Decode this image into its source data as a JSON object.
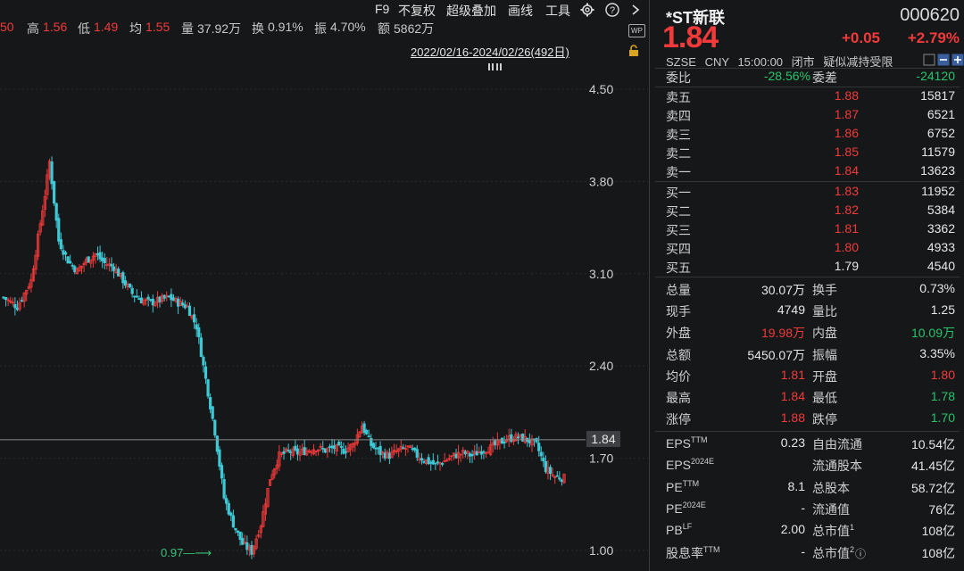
{
  "quote_bar": {
    "partial_open": "50",
    "high_label": "高",
    "high_value": "1.56",
    "low_label": "低",
    "low_value": "1.49",
    "avg_label": "均",
    "avg_value": "1.55",
    "volume_label": "量",
    "volume_value": "37.92万",
    "turnover_label": "换",
    "turnover_value": "0.91%",
    "amplitude_label": "振",
    "amplitude_value": "4.70%",
    "amount_label": "额",
    "amount_value": "5862万"
  },
  "toolbar": {
    "f9": "F9",
    "no_adjust": "不复权",
    "overlay": "超级叠加",
    "draw": "画线",
    "tools": "工具",
    "wp_badge": "WP"
  },
  "date_range": "2022/02/16-2024/02/26(492日)",
  "chart_data": {
    "type": "candlestick",
    "y_ticks": [
      "4.50",
      "3.80",
      "3.10",
      "2.40",
      "1.70",
      "1.00"
    ],
    "ylim": [
      1.0,
      4.5
    ],
    "current_price_label": "1.84",
    "current_price": 1.84,
    "min_label": "0.97",
    "min_value": 0.97,
    "approx_close_path": [
      {
        "i": 0,
        "c": 2.92
      },
      {
        "i": 3,
        "c": 2.85
      },
      {
        "i": 6,
        "c": 3.05
      },
      {
        "i": 9,
        "c": 3.7
      },
      {
        "i": 10,
        "c": 3.95
      },
      {
        "i": 12,
        "c": 3.35
      },
      {
        "i": 14,
        "c": 3.2
      },
      {
        "i": 16,
        "c": 3.12
      },
      {
        "i": 18,
        "c": 3.2
      },
      {
        "i": 20,
        "c": 3.25
      },
      {
        "i": 22,
        "c": 3.18
      },
      {
        "i": 24,
        "c": 3.15
      },
      {
        "i": 26,
        "c": 3.05
      },
      {
        "i": 28,
        "c": 2.95
      },
      {
        "i": 30,
        "c": 2.9
      },
      {
        "i": 32,
        "c": 2.88
      },
      {
        "i": 34,
        "c": 2.9
      },
      {
        "i": 36,
        "c": 2.92
      },
      {
        "i": 38,
        "c": 2.88
      },
      {
        "i": 40,
        "c": 2.85
      },
      {
        "i": 42,
        "c": 2.7
      },
      {
        "i": 44,
        "c": 2.3
      },
      {
        "i": 46,
        "c": 1.9
      },
      {
        "i": 48,
        "c": 1.4
      },
      {
        "i": 50,
        "c": 1.2
      },
      {
        "i": 52,
        "c": 1.05
      },
      {
        "i": 54,
        "c": 0.99
      },
      {
        "i": 56,
        "c": 1.2
      },
      {
        "i": 58,
        "c": 1.55
      },
      {
        "i": 60,
        "c": 1.72
      },
      {
        "i": 62,
        "c": 1.75
      },
      {
        "i": 64,
        "c": 1.74
      },
      {
        "i": 66,
        "c": 1.76
      },
      {
        "i": 68,
        "c": 1.78
      },
      {
        "i": 70,
        "c": 1.76
      },
      {
        "i": 72,
        "c": 1.78
      },
      {
        "i": 74,
        "c": 1.76
      },
      {
        "i": 76,
        "c": 1.8
      },
      {
        "i": 78,
        "c": 1.95
      },
      {
        "i": 80,
        "c": 1.8
      },
      {
        "i": 82,
        "c": 1.74
      },
      {
        "i": 84,
        "c": 1.72
      },
      {
        "i": 86,
        "c": 1.76
      },
      {
        "i": 88,
        "c": 1.78
      },
      {
        "i": 90,
        "c": 1.72
      },
      {
        "i": 92,
        "c": 1.68
      },
      {
        "i": 94,
        "c": 1.65
      },
      {
        "i": 96,
        "c": 1.68
      },
      {
        "i": 98,
        "c": 1.72
      },
      {
        "i": 100,
        "c": 1.74
      },
      {
        "i": 102,
        "c": 1.72
      },
      {
        "i": 104,
        "c": 1.76
      },
      {
        "i": 106,
        "c": 1.78
      },
      {
        "i": 108,
        "c": 1.82
      },
      {
        "i": 110,
        "c": 1.85
      },
      {
        "i": 112,
        "c": 1.86
      },
      {
        "i": 114,
        "c": 1.84
      },
      {
        "i": 116,
        "c": 1.8
      },
      {
        "i": 118,
        "c": 1.62
      },
      {
        "i": 120,
        "c": 1.56
      },
      {
        "i": 122,
        "c": 1.55
      }
    ],
    "colors": {
      "up": "#f23a3a",
      "down": "#3fc9d6",
      "flat": "#e8e0a0",
      "grid": "#2a2c30",
      "price_line": "#8a8a8a"
    }
  },
  "stock": {
    "name": "*ST新联",
    "code": "000620",
    "price": "1.84",
    "change": "+0.05",
    "change_pct": "+2.79%",
    "exchange": "SZSE",
    "currency": "CNY",
    "time": "15:00:00",
    "status": "闭市",
    "flag": "疑似减持受限"
  },
  "book": {
    "ratio_label": "委比",
    "ratio_value": "-28.56%",
    "diff_label": "委差",
    "diff_value": "-24120",
    "asks": [
      {
        "label": "卖五",
        "price": "1.88",
        "qty": "15817"
      },
      {
        "label": "卖四",
        "price": "1.87",
        "qty": "6521"
      },
      {
        "label": "卖三",
        "price": "1.86",
        "qty": "6752"
      },
      {
        "label": "卖二",
        "price": "1.85",
        "qty": "11579"
      },
      {
        "label": "卖一",
        "price": "1.84",
        "qty": "13623"
      }
    ],
    "bids": [
      {
        "label": "买一",
        "price": "1.83",
        "qty": "11952"
      },
      {
        "label": "买二",
        "price": "1.82",
        "qty": "5384"
      },
      {
        "label": "买三",
        "price": "1.81",
        "qty": "3362"
      },
      {
        "label": "买四",
        "price": "1.80",
        "qty": "4933"
      },
      {
        "label": "买五",
        "price": "1.79",
        "qty": "4540"
      }
    ]
  },
  "stats": {
    "total_vol_label": "总量",
    "total_vol": "30.07万",
    "turn_label": "换手",
    "turn": "0.73%",
    "cur_vol_label": "现手",
    "cur_vol": "4749",
    "vol_ratio_label": "量比",
    "vol_ratio": "1.25",
    "outer_label": "外盘",
    "outer": "19.98万",
    "inner_label": "内盘",
    "inner": "10.09万",
    "amount_label": "总额",
    "amount": "5450.07万",
    "amp_label": "振幅",
    "amp": "3.35%",
    "avg_label": "均价",
    "avg": "1.81",
    "open_label": "开盘",
    "open": "1.80",
    "high_label": "最高",
    "high": "1.84",
    "low_label": "最低",
    "low": "1.78",
    "limit_up_label": "涨停",
    "limit_up": "1.88",
    "limit_down_label": "跌停",
    "limit_down": "1.70"
  },
  "fundamentals": {
    "eps_ttm_label": "EPS",
    "eps_ttm_sup": "TTM",
    "eps_ttm": "0.23",
    "free_float_label": "自由流通",
    "free_float": "10.54亿",
    "eps_2024_label": "EPS",
    "eps_2024_sup": "2024E",
    "eps_2024": "",
    "float_shares_label": "流通股本",
    "float_shares": "41.45亿",
    "pe_ttm_label": "PE",
    "pe_ttm_sup": "TTM",
    "pe_ttm": "8.1",
    "total_shares_label": "总股本",
    "total_shares": "58.72亿",
    "pe_2024_label": "PE",
    "pe_2024_sup": "2024E",
    "pe_2024": "-",
    "float_mv_label": "流通值",
    "float_mv": "76亿",
    "pb_label": "PB",
    "pb_sup": "LF",
    "pb": "2.00",
    "mv1_label": "总市值",
    "mv1_sup": "1",
    "mv1": "108亿",
    "div_label": "股息率",
    "div_sup": "TTM",
    "div": "-",
    "mv2_label": "总市值",
    "mv2_sup": "2",
    "mv2": "108亿"
  }
}
